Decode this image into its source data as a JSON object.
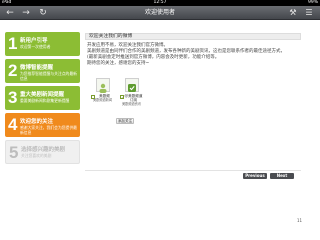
{
  "status_bar": {
    "device": "iPad",
    "time": "12:57",
    "battery": "99%"
  },
  "nav": {
    "title": "欢迎使用者"
  },
  "steps": [
    {
      "num": "1",
      "title": "新用户引导",
      "desc": "欢迎第一次使用者"
    },
    {
      "num": "2",
      "title": "微博智能提醒",
      "desc": "为您推荐智能提醒与关注点的最新信息"
    },
    {
      "num": "3",
      "title": "重大美剧新闻提醒",
      "desc": "重要美剧新闻和剧集更新提醒"
    },
    {
      "num": "4",
      "title": "欢迎您的关注",
      "desc": "感谢大家关注，我们会为您提供最新信息"
    },
    {
      "num": "5",
      "title": "选择感兴趣的美剧",
      "desc": "关注您喜欢的美剧"
    }
  ],
  "content": {
    "section_title": "欢迎关注我们的微博",
    "description": [
      "开发应用不易，欢迎关注我们官方微博。",
      "美剧频道是由同伴们合作的美剧频道，发布各种新的美剧资讯，这也是您联系作者的最佳途径方式，",
      "(最新美剧会定时推送到官方微博，内容会及时更新，功能介绍等。",
      "期待您的关注，感谢您的支持~"
    ],
    "cards": [
      {
        "name": "美剧频",
        "desc": "美剧频道新闻",
        "checked": ""
      },
      {
        "name": "@美剧频道订阅",
        "desc": "美剧频道资讯",
        "checked": "✓"
      }
    ],
    "follow_label": "添加关注"
  },
  "footer": {
    "prev_label": "Previous",
    "next_label": "Next",
    "page_number": "11"
  },
  "colors": {
    "green": "#8cbd34",
    "orange": "#f08a1c",
    "nav": "#55585d"
  }
}
